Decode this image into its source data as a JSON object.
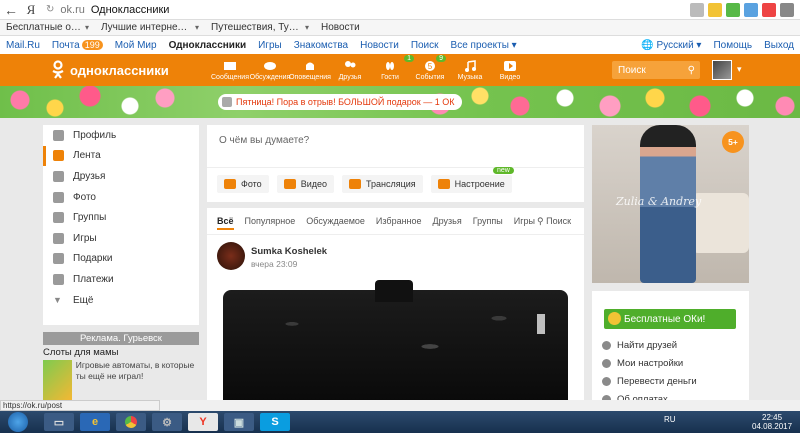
{
  "browser": {
    "back": "←",
    "logo": "Я",
    "url": "ok.ru",
    "title": "Одноклассники"
  },
  "bookmarks": [
    {
      "label": "Бесплатные онлайн и"
    },
    {
      "label": "Лучшие интернет-ма"
    },
    {
      "label": "Путешествия, Туризм"
    },
    {
      "label": "Новости"
    }
  ],
  "portal": {
    "links": [
      "Mail.Ru",
      "Почта",
      "Мой Мир",
      "Одноклассники",
      "Игры",
      "Знакомства",
      "Новости",
      "Поиск",
      "Все проекты ▾"
    ],
    "mail_count": "199",
    "language": "Русский ▾",
    "help": "Помощь",
    "logout": "Выход"
  },
  "ok": {
    "logo_text": "одноклассники",
    "nav": [
      {
        "label": "Сообщения"
      },
      {
        "label": "Обсуждения"
      },
      {
        "label": "Оповещения"
      },
      {
        "label": "Друзья"
      },
      {
        "label": "Гости",
        "count": "1"
      },
      {
        "label": "События",
        "count": "9"
      },
      {
        "label": "Музыка"
      },
      {
        "label": "Видео"
      }
    ],
    "guests_count": "1",
    "events_count": "9",
    "events_badge": "5",
    "search_placeholder": "Поиск",
    "brand_color": "#ee8208"
  },
  "promo": "Пятница! Пора в отрыв! БОЛЬШОЙ подарок — 1 ОК",
  "sidebar": [
    {
      "label": "Профиль",
      "icon": "user-icon"
    },
    {
      "label": "Лента",
      "icon": "feed-icon"
    },
    {
      "label": "Друзья",
      "icon": "friends-icon"
    },
    {
      "label": "Фото",
      "icon": "camera-icon"
    },
    {
      "label": "Группы",
      "icon": "groups-icon"
    },
    {
      "label": "Игры",
      "icon": "gamepad-icon"
    },
    {
      "label": "Подарки",
      "icon": "gift-icon"
    },
    {
      "label": "Платежи",
      "icon": "wallet-icon"
    },
    {
      "label": "Ещё",
      "icon": "chevron-down-icon"
    }
  ],
  "ad": {
    "header": "Реклама. Гурьевск",
    "title": "Слоты для мамы",
    "text": "Игровые автоматы, в которые ты ещё не играл!"
  },
  "composer": {
    "placeholder": "О чём вы думаете?",
    "actions": [
      "Фото",
      "Видео",
      "Трансляция",
      "Настроение"
    ],
    "new_badge": "new"
  },
  "feed": {
    "tabs": [
      "Всё",
      "Популярное",
      "Обсуждаемое",
      "Избранное",
      "Друзья",
      "Группы",
      "Игры"
    ],
    "search": "Поиск",
    "post": {
      "author": "Sumka Koshelek",
      "time": "вчера 23:09"
    }
  },
  "right_ad": {
    "age": "5+",
    "signature": "Zulia & Andrey"
  },
  "right_box": {
    "free_ok": "Бесплатные ОКи!",
    "links": [
      "Найти друзей",
      "Мои настройки",
      "Перевести деньги",
      "Об оплатах"
    ]
  },
  "status_url": "https://ok.ru/post",
  "taskbar": {
    "lang": "RU",
    "time": "22:45",
    "date": "04.08.2017"
  }
}
